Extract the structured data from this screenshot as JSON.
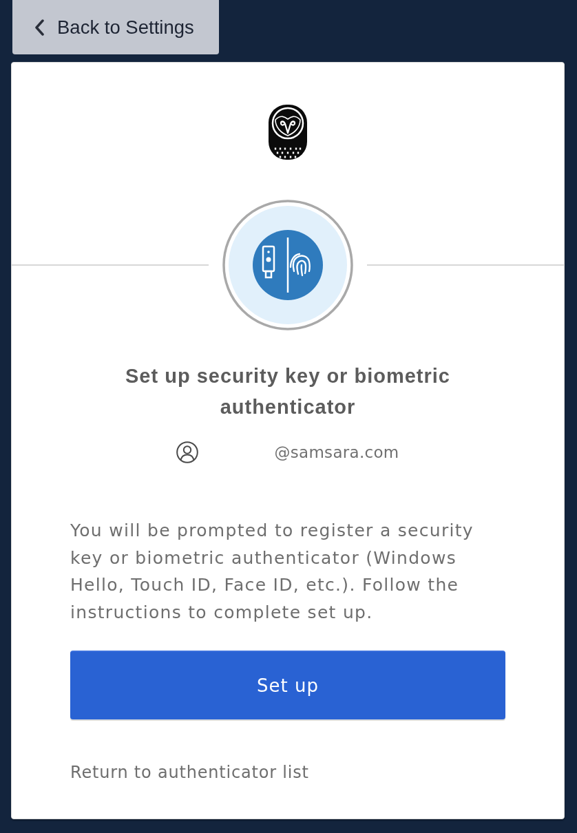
{
  "back_button": {
    "label": "Back to Settings"
  },
  "card": {
    "title": "Set up security key or biometric authenticator",
    "account": {
      "email": "@samsara.com"
    },
    "instructions": "You will be prompted to register a security key or biometric authenticator (Windows Hello, Touch ID, Face ID, etc.). Follow the instructions to complete set up.",
    "primary_button": {
      "label": "Set up"
    },
    "link": {
      "label": "Return to authenticator list"
    }
  }
}
